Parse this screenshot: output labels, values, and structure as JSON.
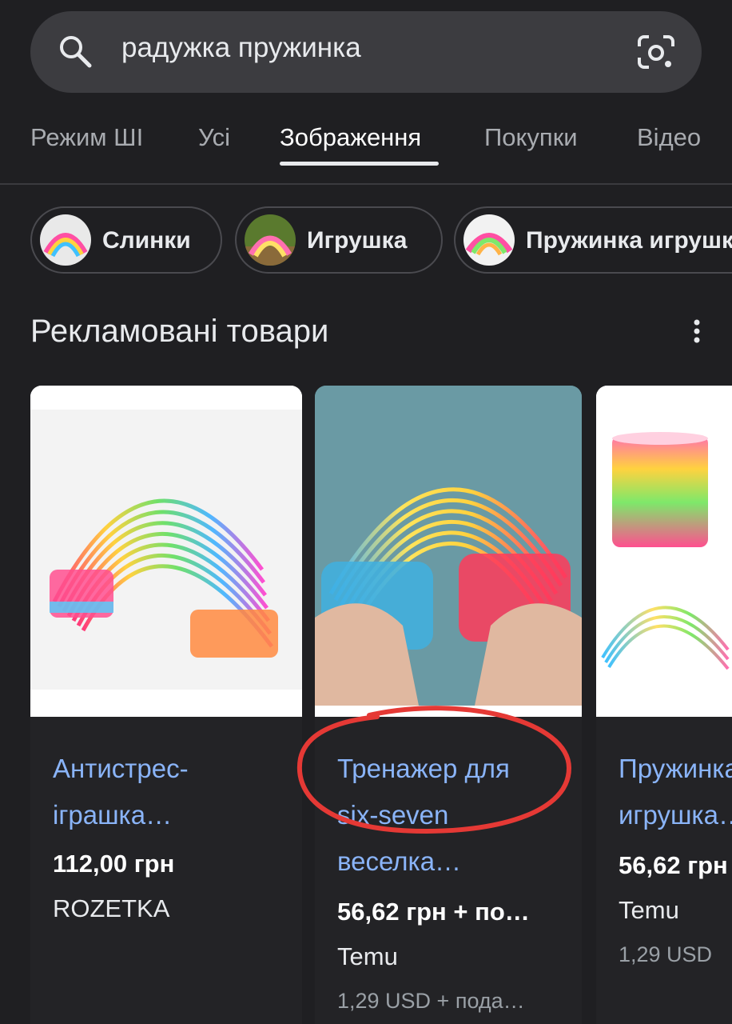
{
  "search": {
    "query": "радужка пружинка"
  },
  "tabs": [
    {
      "label": "Режим ШІ"
    },
    {
      "label": "Усі"
    },
    {
      "label": "Зображення",
      "active": true
    },
    {
      "label": "Покупки"
    },
    {
      "label": "Відео"
    }
  ],
  "chips": [
    {
      "label": "Слинки"
    },
    {
      "label": "Игрушка"
    },
    {
      "label": "Пружинка игрушка"
    }
  ],
  "section": {
    "title": "Рекламовані товари"
  },
  "products": [
    {
      "title_line1": "Антистрес-",
      "title_line2": "іграшка…",
      "price": "112,00 грн",
      "store": "ROZETKA"
    },
    {
      "title_line1": "Тренажер для",
      "title_line2": "six-seven",
      "title_line3": "веселка…",
      "price": "56,62 грн + по…",
      "store": "Temu",
      "shipping": "1,29 USD + пода…"
    },
    {
      "title_line1": "Пружинка",
      "title_line2": "игрушка…",
      "price": "56,62 грн",
      "store": "Temu",
      "shipping": "1,29 USD"
    }
  ],
  "colors": {
    "background": "#1f1f22",
    "link": "#8ab4f8",
    "annotation": "#e53935"
  }
}
